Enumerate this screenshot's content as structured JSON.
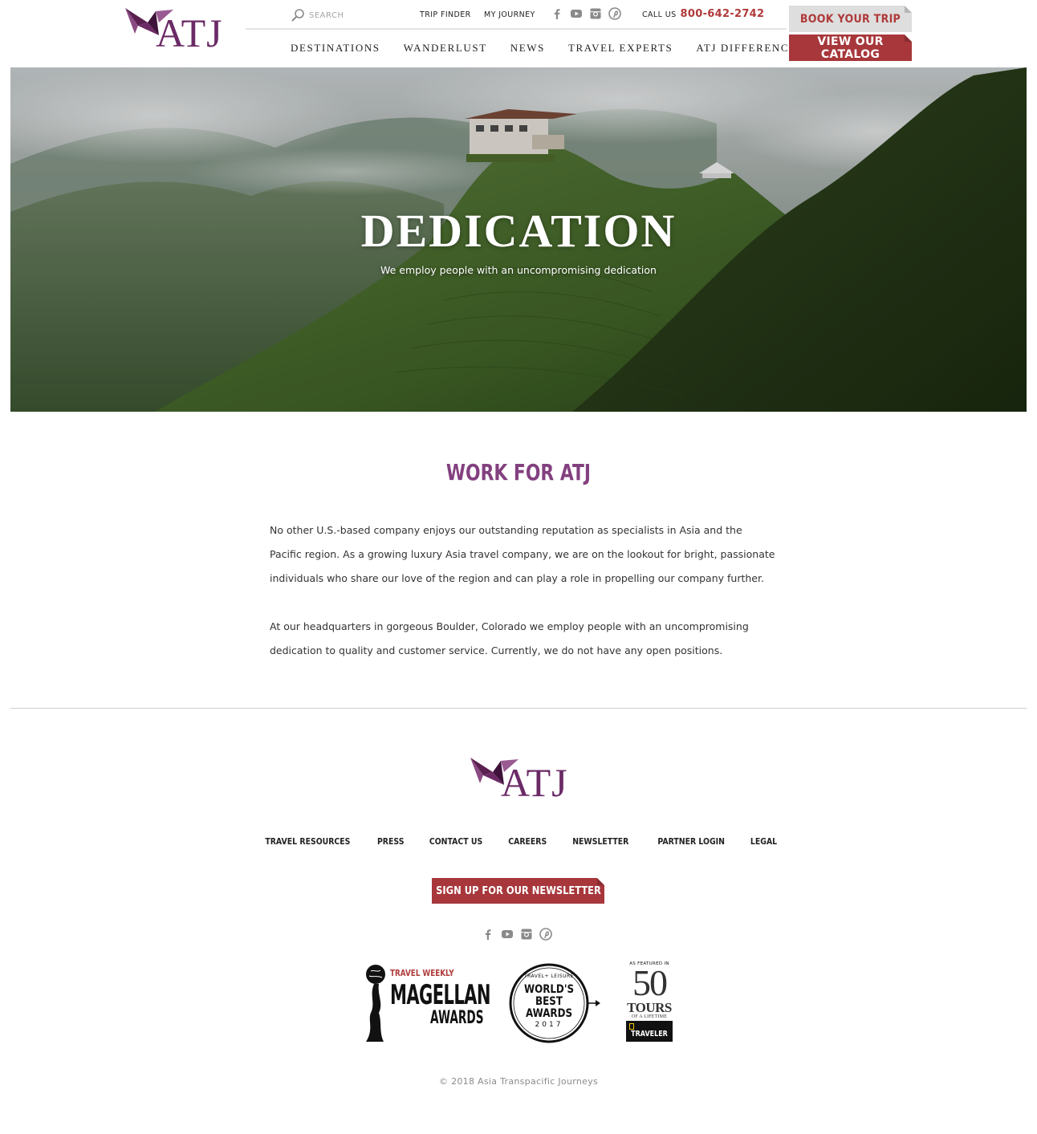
{
  "header": {
    "logo_text": "ATJ",
    "search_placeholder": "SEARCH",
    "utility_links": [
      "TRIP FINDER",
      "MY JOURNEY"
    ],
    "social_icons": [
      "facebook-icon",
      "youtube-icon",
      "instagram-icon",
      "pinterest-icon"
    ],
    "call_label": "CALL US",
    "phone": "800-642-2742",
    "nav": [
      "DESTINATIONS",
      "WANDERLUST",
      "NEWS",
      "TRAVEL EXPERTS",
      "ATJ DIFFERENCE"
    ],
    "book_button": "BOOK YOUR TRIP",
    "catalog_button": "VIEW OUR CATALOG"
  },
  "hero": {
    "title": "DEDICATION",
    "subtitle": "We employ people with an uncompromising dedication"
  },
  "main": {
    "title": "WORK FOR ATJ",
    "paragraphs": [
      "No other U.S.-based company enjoys our outstanding reputation as specialists in Asia and the Pacific region. As a growing luxury Asia travel company, we are on the lookout for bright, passionate individuals who share our love of the region and can play a role in propelling our company further.",
      "At our headquarters in gorgeous Boulder, Colorado we employ people with an uncompromising dedication to quality and customer service. Currently, we do not have any open positions."
    ]
  },
  "footer": {
    "logo_text": "ATJ",
    "links": [
      "TRAVEL RESOURCES",
      "PRESS",
      "CONTACT US",
      "CAREERS",
      "NEWSLETTER",
      "PARTNER LOGIN",
      "LEGAL"
    ],
    "newsletter_button": "SIGN UP FOR OUR NEWSLETTER",
    "awards": {
      "magellan": {
        "publisher": "TRAVEL WEEKLY",
        "name": "MAGELLAN",
        "sub": "AWARDS"
      },
      "travel_leisure": {
        "publisher": "TRAVEL+ LEISURE",
        "name": "WORLD'S BEST AWARDS",
        "year": "2017"
      },
      "nat_geo": {
        "top": "AS FEATURED IN",
        "number": "50",
        "line1": "TOURS",
        "line2": "OF A LIFETIME",
        "badge": "TRAVELER"
      }
    },
    "copyright": "© 2018 Asia Transpacific Journeys"
  },
  "colors": {
    "brand_purple": "#6b2a66",
    "title_purple": "#83407f",
    "accent_red": "#a7373b",
    "phone_red": "#b03a3a"
  }
}
